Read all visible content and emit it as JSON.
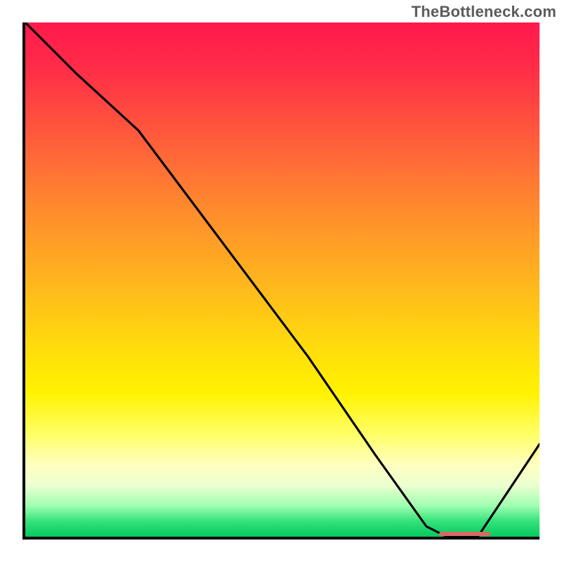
{
  "watermark": "TheBottleneck.com",
  "chart_data": {
    "type": "line",
    "title": "",
    "xlabel": "",
    "ylabel": "",
    "xlim": [
      0,
      100
    ],
    "ylim": [
      0,
      100
    ],
    "grid": false,
    "legend": false,
    "series": [
      {
        "name": "curve",
        "x": [
          0,
          10,
          22,
          40,
          55,
          68,
          78,
          82,
          88,
          100
        ],
        "y": [
          100,
          90,
          79,
          55,
          35,
          16,
          2,
          0,
          0,
          18
        ]
      }
    ],
    "gradient_stops": [
      {
        "pos": 0.0,
        "color": "#ff1a4d"
      },
      {
        "pos": 0.36,
        "color": "#ff8a2e"
      },
      {
        "pos": 0.62,
        "color": "#ffd90f"
      },
      {
        "pos": 0.86,
        "color": "#ffffc0"
      },
      {
        "pos": 1.0,
        "color": "#06c95e"
      }
    ],
    "optimum_band": {
      "x_start": 80,
      "x_end": 90
    }
  },
  "colors": {
    "curve": "#000000",
    "axis": "#000000",
    "pip": "#d76a63"
  }
}
